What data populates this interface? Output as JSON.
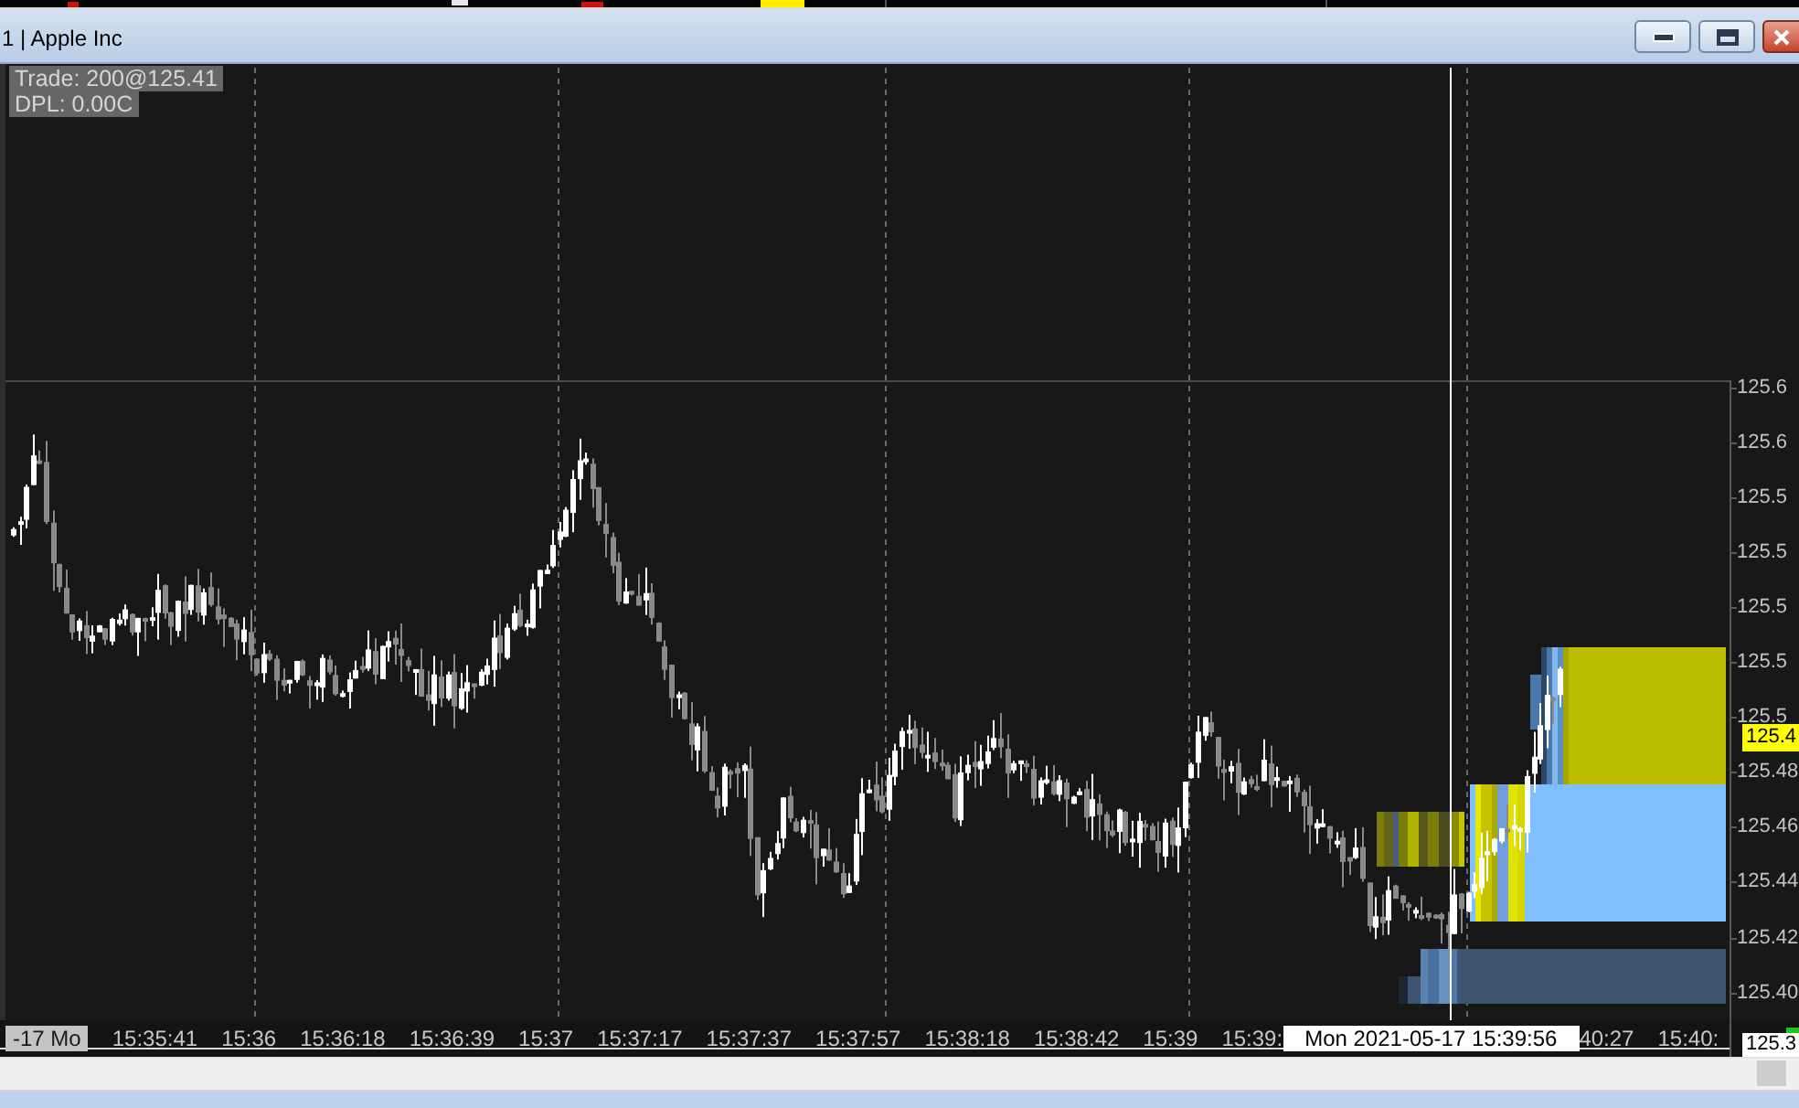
{
  "window": {
    "title": "1 | Apple Inc"
  },
  "chart": {
    "info_lines": [
      "Trade: 200@125.41",
      "DPL: 0.00C"
    ],
    "price_axis": {
      "labels": [
        "125.6",
        "125.6",
        "125.5",
        "125.5",
        "125.5",
        "125.5",
        "125.5",
        "125.48",
        "125.46",
        "125.44",
        "125.42",
        "125.40"
      ],
      "last_price": "125.4",
      "crosshair_price": "125.3"
    },
    "time_axis": {
      "date_label": "-17 Mo",
      "labels": [
        "15:35:41",
        "15:36",
        "15:36:18",
        "15:36:39",
        "15:37",
        "15:37:17",
        "15:37:37",
        "15:37:57",
        "15:38:18",
        "15:38:42",
        "15:39",
        "15:39:"
      ],
      "crosshair_time": "Mon 2021-05-17 15:39:56",
      "labels_after": [
        "40:27",
        "15:40:"
      ]
    }
  }
}
